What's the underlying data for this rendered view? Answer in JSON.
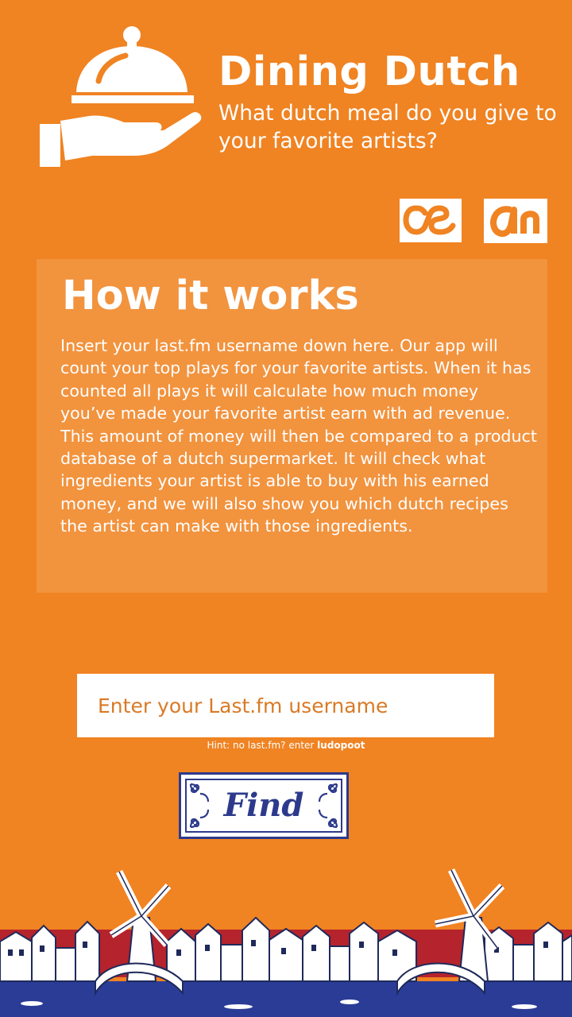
{
  "header": {
    "title": "Dining Dutch",
    "subtitle": "What dutch meal do you give to your favorite artists?",
    "icon": "cloche-hand-icon"
  },
  "logos": {
    "lastfm": "lastfm-logo",
    "ah": "albert-heijn-logo"
  },
  "info": {
    "heading": "How it works",
    "body": "Insert your last.fm username down here. Our app will count your top plays for your favorite artists. When it has counted all plays it will calculate how much money you’ve  made your favorite artist earn with ad revenue. This amount of money will then be compared to a product database of a dutch supermarket. It will check what ingredients your artist is able to buy with his earned money, and we will also show you which dutch recipes the artist can make with those ingredients."
  },
  "form": {
    "placeholder": "Enter your Last.fm username",
    "value": "",
    "hint_prefix": "Hint: no last.fm? enter ",
    "hint_username": "ludopoot",
    "find_label": "Find"
  },
  "colors": {
    "background": "#f08322",
    "button_blue": "#2d3a8c",
    "skyline_red": "#b5232d",
    "skyline_blue": "#2b3c97"
  },
  "footer": {
    "illustration": "dutch-skyline-windmills-illustration"
  }
}
